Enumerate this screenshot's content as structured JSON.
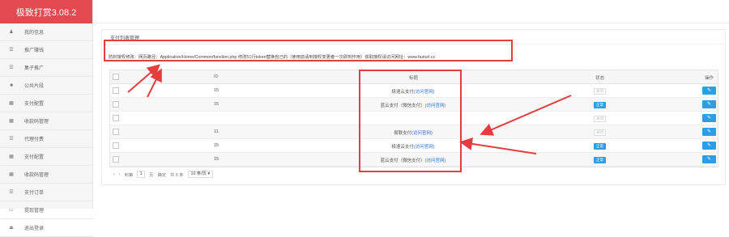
{
  "app": {
    "brand": "极致打赏3.08.2"
  },
  "sidebar": {
    "items": [
      {
        "label": "我的信息",
        "icon": "user-icon"
      },
      {
        "label": "推广赚钱",
        "icon": "list-icon"
      },
      {
        "label": "集子推广",
        "icon": "list-icon"
      },
      {
        "label": "公共片段",
        "icon": "video-icon"
      },
      {
        "label": "支付配置",
        "icon": "grid-icon"
      },
      {
        "label": "收款码管理",
        "icon": "grid-icon"
      },
      {
        "label": "代理付费",
        "icon": "list-icon"
      },
      {
        "label": "支付配置",
        "icon": "grid-icon"
      },
      {
        "label": "收款码管理",
        "icon": "grid-icon"
      },
      {
        "label": "支付订单",
        "icon": "list-icon"
      },
      {
        "label": "提现管理",
        "icon": "card-icon"
      },
      {
        "label": "退出登录",
        "icon": "exit-icon"
      }
    ]
  },
  "panel": {
    "title": "支付列表管理"
  },
  "notice": "防封授权修改：网页路径：Application/Home/Common/function.php 修改51行token替换自己的（使用前请到授权变更者一次即刻作用）获取授权请访问网址：www.fasturl.cc",
  "table": {
    "headers": {
      "id": "ID",
      "title": "标题",
      "status": "状态",
      "action": "操作"
    },
    "rows": [
      {
        "id": "15",
        "title": "极速云支付",
        "link": "(访问官网)",
        "status": "关闭",
        "status_on": false
      },
      {
        "id": "15",
        "title": "蓝云支付（微信支付）",
        "link": "(访问官网)",
        "status": "正常",
        "status_on": true
      },
      {
        "id": "",
        "title": "",
        "link": "",
        "status": "关闭",
        "status_on": false
      },
      {
        "id": "11",
        "title": "易联支付",
        "link": "(访问官网)",
        "status": "关闭",
        "status_on": false
      },
      {
        "id": "15",
        "title": "极速云支付",
        "link": "(访问官网)",
        "status": "正常",
        "status_on": true
      },
      {
        "id": "15",
        "title": "蓝云支付（微信支付）",
        "link": "(访问官网)",
        "status": "正常",
        "status_on": true
      }
    ]
  },
  "pager": {
    "goto": "到第",
    "page": "1",
    "unit": "页",
    "confirm": "确定",
    "total": "共 6 条",
    "per_page": "10 条/页"
  },
  "colors": {
    "brand": "#e24a4f",
    "accent": "#2d9ee6",
    "annotation": "#e33d3d"
  }
}
